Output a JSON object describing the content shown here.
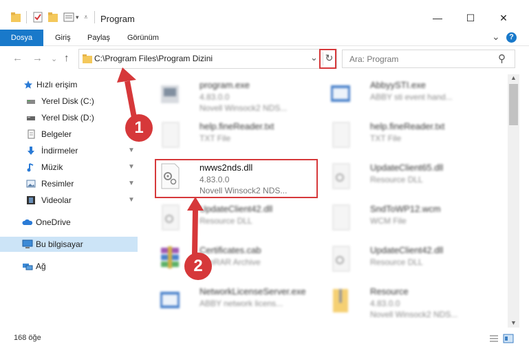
{
  "window": {
    "title": "Program",
    "minimize_glyph": "—",
    "maximize_glyph": "☐",
    "close_glyph": "✕"
  },
  "ribbon": {
    "tabs": [
      "Dosya",
      "Giriş",
      "Paylaş",
      "Görünüm"
    ],
    "active_tab": "Dosya",
    "help_glyph": "?",
    "expand_glyph": "⌄"
  },
  "address": {
    "path": "C:\\Program Files\\Program Dizini",
    "dropdown_glyph": "⌄",
    "refresh_glyph": "↻"
  },
  "search": {
    "placeholder": "Ara: Program",
    "icon_glyph": "⚲"
  },
  "nav": {
    "back_glyph": "←",
    "forward_glyph": "→",
    "recent_glyph": "⌄",
    "up_glyph": "↑"
  },
  "sidebar": {
    "items": [
      {
        "label": "Hızlı erişim",
        "icon": "star-icon"
      },
      {
        "label": "Yerel Disk (C:)",
        "icon": "drive-icon"
      },
      {
        "label": "Yerel Disk (D:)",
        "icon": "drive-icon"
      },
      {
        "label": "Belgeler",
        "icon": "documents-icon"
      },
      {
        "label": "İndirmeler",
        "icon": "download-icon"
      },
      {
        "label": "Müzik",
        "icon": "music-icon"
      },
      {
        "label": "Resimler",
        "icon": "pictures-icon"
      },
      {
        "label": "Videolar",
        "icon": "videos-icon"
      },
      {
        "label": "OneDrive",
        "icon": "cloud-icon"
      },
      {
        "label": "Bu bilgisayar",
        "icon": "computer-icon"
      },
      {
        "label": "Ağ",
        "icon": "network-icon"
      }
    ],
    "pin_glyph": "📌"
  },
  "files": [
    {
      "name": "program.exe",
      "line1": "4.83.0.0",
      "line2": "Novell Winsock2 NDS...",
      "icon": "exe-icon"
    },
    {
      "name": "AbbyySTI.exe",
      "line1": "ABBY sti event hand...",
      "line2": "",
      "icon": "exe-icon"
    },
    {
      "name": "help.fineReader.txt",
      "line1": "TXT File",
      "line2": "",
      "icon": "text-file-icon"
    },
    {
      "name": "help.fineReader.txt",
      "line1": "TXT File",
      "line2": "",
      "icon": "text-file-icon"
    },
    {
      "name": "nwws2nds.dll",
      "line1": "4.83.0.0",
      "line2": "Novell Winsock2 NDS...",
      "icon": "dll-icon"
    },
    {
      "name": "UpdateClient65.dll",
      "line1": "Resource DLL",
      "line2": "",
      "icon": "dll-icon"
    },
    {
      "name": "UpdateClient42.dll",
      "line1": "Resource DLL",
      "line2": "",
      "icon": "dll-icon"
    },
    {
      "name": "SndToWP12.wcm",
      "line1": "WCM File",
      "line2": "",
      "icon": "file-icon"
    },
    {
      "name": "Certificates.cab",
      "line1": "WinRAR Archive",
      "line2": "",
      "icon": "archive-icon"
    },
    {
      "name": "UpdateClient42.dll",
      "line1": "Resource DLL",
      "line2": "",
      "icon": "dll-icon"
    },
    {
      "name": "NetworkLicenseServer.exe",
      "line1": "ABBY network licens...",
      "line2": "",
      "icon": "exe-icon"
    },
    {
      "name": "Resource",
      "line1": "4.83.0.0",
      "line2": "Novell Winsock2 NDS...",
      "icon": "folder-zip-icon"
    }
  ],
  "status": {
    "count": "168 öğe"
  },
  "callouts": {
    "first": "1",
    "second": "2"
  },
  "colors": {
    "accent": "#1979ca",
    "highlight": "#d6383a",
    "selected_nav": "#cce4f7"
  }
}
